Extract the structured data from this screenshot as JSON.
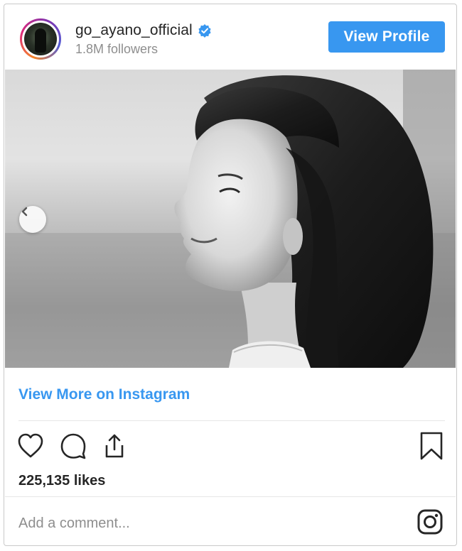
{
  "header": {
    "username": "go_ayano_official",
    "followers": "1.8M followers",
    "view_profile_label": "View Profile"
  },
  "post": {
    "view_more_label": "View More on Instagram",
    "likes": "225,135 likes",
    "comment_placeholder": "Add a comment..."
  },
  "icons": {
    "verified": "verified-badge-icon",
    "prev": "chevron-left-icon",
    "like": "heart-icon",
    "comment": "comment-bubble-icon",
    "share": "share-icon",
    "save": "bookmark-icon",
    "brand": "instagram-icon"
  },
  "colors": {
    "accent": "#3897f0",
    "text": "#262626",
    "muted": "#8e8e8e",
    "border": "#c9c9c9"
  }
}
